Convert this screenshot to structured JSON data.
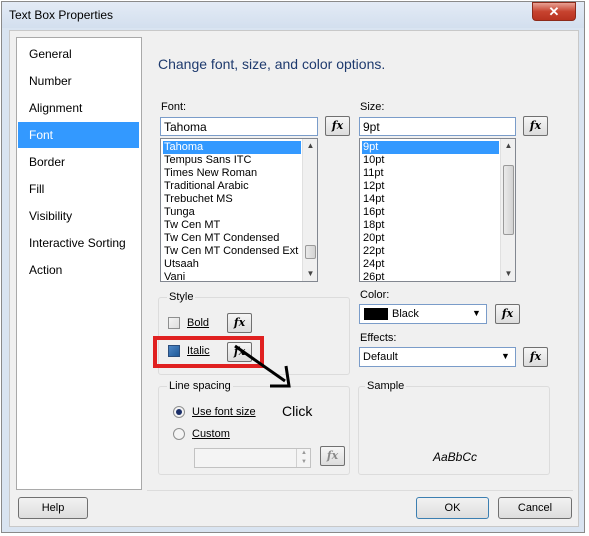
{
  "window": {
    "title": "Text Box Properties",
    "close_glyph": "✕"
  },
  "nav": {
    "items": [
      {
        "label": "General"
      },
      {
        "label": "Number"
      },
      {
        "label": "Alignment"
      },
      {
        "label": "Font",
        "selected": true
      },
      {
        "label": "Border"
      },
      {
        "label": "Fill"
      },
      {
        "label": "Visibility"
      },
      {
        "label": "Interactive Sorting"
      },
      {
        "label": "Action"
      }
    ]
  },
  "content": {
    "heading": "Change font, size, and color options.",
    "font": {
      "label": "Font:",
      "value": "Tahoma",
      "list": [
        "Tahoma",
        "Tempus Sans ITC",
        "Times New Roman",
        "Traditional Arabic",
        "Trebuchet MS",
        "Tunga",
        "Tw Cen MT",
        "Tw Cen MT Condensed",
        "Tw Cen MT Condensed Ext",
        "Utsaah",
        "Vani"
      ],
      "selected": "Tahoma"
    },
    "size": {
      "label": "Size:",
      "value": "9pt",
      "list": [
        "9pt",
        "10pt",
        "11pt",
        "12pt",
        "14pt",
        "16pt",
        "18pt",
        "20pt",
        "22pt",
        "24pt",
        "26pt"
      ],
      "selected": "9pt"
    },
    "style": {
      "group_label": "Style",
      "bold_label": "Bold",
      "bold_checked": false,
      "italic_label": "Italic",
      "italic_checked": false
    },
    "color": {
      "label": "Color:",
      "value": "Black",
      "swatch": "#000000"
    },
    "effects": {
      "label": "Effects:",
      "value": "Default"
    },
    "line_spacing": {
      "group_label": "Line spacing",
      "option_font_size": "Use font size",
      "option_custom": "Custom",
      "selected": "Use font size",
      "custom_value": ""
    },
    "sample": {
      "group_label": "Sample",
      "text": "AaBbCc"
    },
    "fx_label": "fx",
    "annotation": {
      "text": "Click",
      "highlight_color": "#e02020"
    }
  },
  "footer": {
    "help_label": "Help",
    "ok_label": "OK",
    "cancel_label": "Cancel"
  }
}
